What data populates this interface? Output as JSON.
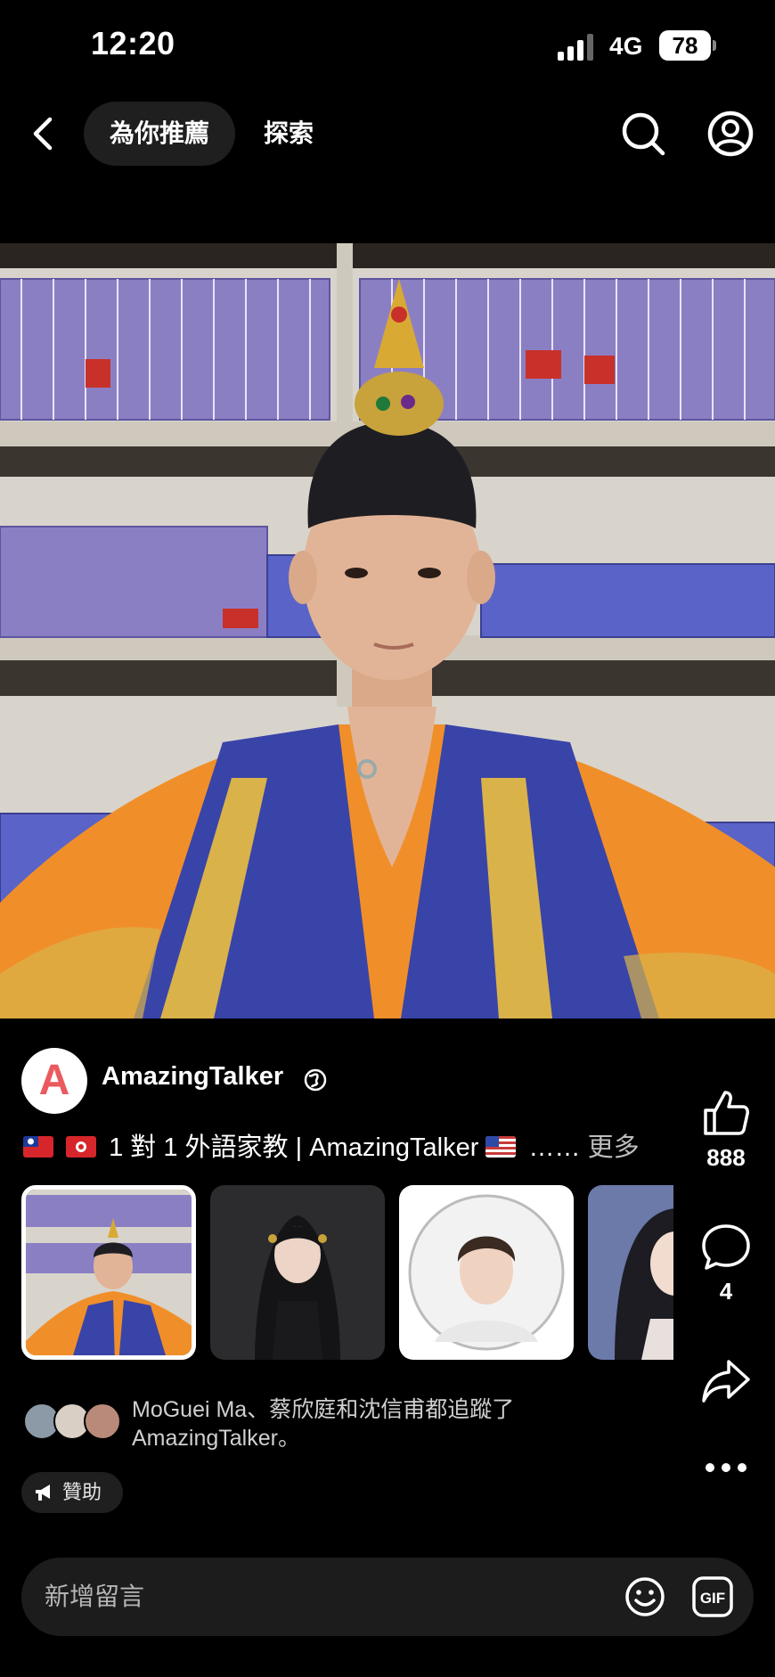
{
  "status_bar": {
    "time": "12:20",
    "network": "4G",
    "battery": "78"
  },
  "nav": {
    "tabs": [
      {
        "label": "為你推薦",
        "active": true
      },
      {
        "label": "探索",
        "active": false
      }
    ]
  },
  "post": {
    "page_name": "AmazingTalker",
    "avatar_letter": "A",
    "caption": "1 對 1 外語家教 | AmazingTalker ",
    "caption_ellipsis": "……",
    "more_label": "更多",
    "sponsored_label": "贊助",
    "followers_text": "MoGuei Ma、蔡欣庭和沈信甫都追蹤了AmazingTalker。"
  },
  "actions": {
    "likes": "888",
    "comments": "4"
  },
  "comment_bar": {
    "placeholder": "新增留言"
  },
  "icons": {
    "back": "chevron-left-icon",
    "search": "search-icon",
    "profile": "profile-icon",
    "globe": "globe-icon",
    "like": "thumbs-up-icon",
    "comment": "comment-icon",
    "share": "share-icon",
    "more": "more-icon",
    "emoji": "emoji-icon",
    "gif": "gif-icon",
    "sponsored": "megaphone-icon"
  },
  "colors": {
    "brand_avatar": "#ea5a5f",
    "background": "#000000",
    "pill": "#1f1f1f"
  }
}
